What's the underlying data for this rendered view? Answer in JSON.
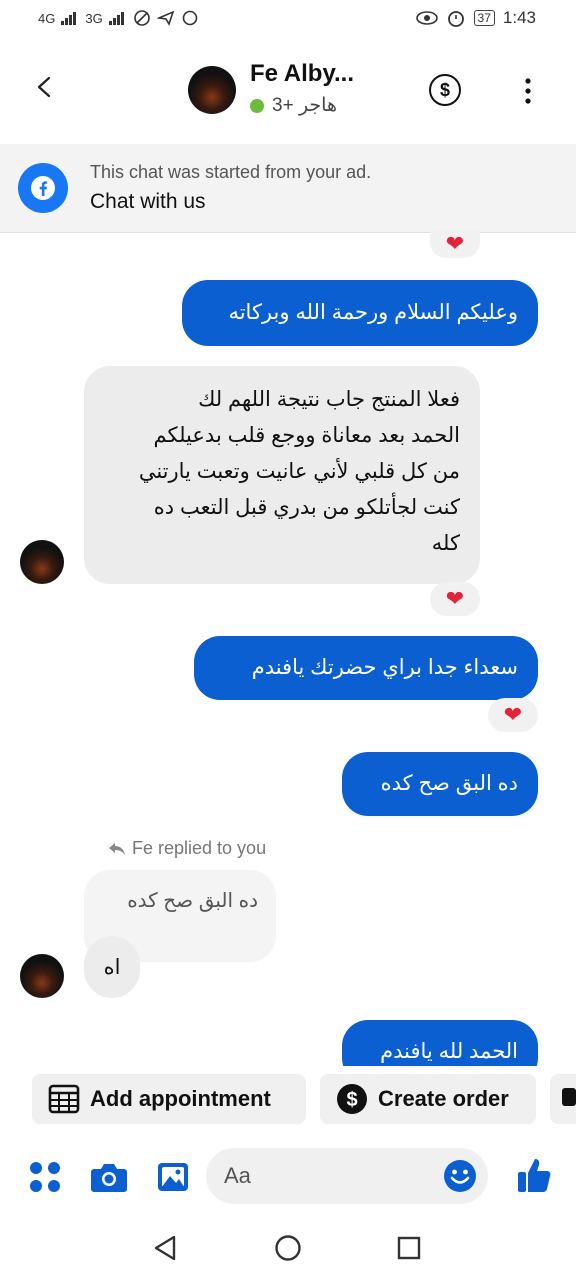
{
  "status_bar": {
    "network_1": "4G",
    "network_2": "3G",
    "battery": "37",
    "time": "1:43"
  },
  "header": {
    "back_icon": "chevron-left-icon",
    "title": "Fe Alby...",
    "subtitle": "هاجر +3",
    "status_color": "#6dbb3c",
    "dollar_icon": "dollar-circle-icon",
    "more_icon": "more-vertical-icon"
  },
  "ad_banner": {
    "icon": "facebook-icon",
    "note": "This chat was started from your ad.",
    "cta": "Chat with us"
  },
  "messages": [
    {
      "direction": "out",
      "text": "وعليكم السلام ورحمة الله وبركاته"
    },
    {
      "direction": "in",
      "lines": [
        "فعلا المنتج جاب نتيجة اللهم لك",
        "الحمد بعد معاناة ووجع قلب بدعيلكم",
        "من كل قلبي لأني عانيت وتعبت يارتني",
        "كنت لجأتلكو من بدري قبل التعب ده",
        "كله"
      ],
      "reaction": "heart"
    },
    {
      "direction": "out",
      "text": "سعداء جدا براي حضرتك يافندم",
      "reaction": "heart"
    },
    {
      "direction": "out",
      "text": "ده البق صح كده"
    },
    {
      "direction": "in",
      "reply_note": "Fe replied to you",
      "quoted": "ده البق صح كده",
      "text": "اه"
    },
    {
      "direction": "out",
      "text": "الحمد لله يافندم"
    }
  ],
  "quick_actions": [
    {
      "icon": "calendar-icon",
      "label": "Add appointment"
    },
    {
      "icon": "dollar-circle-icon",
      "label": "Create order"
    }
  ],
  "composer": {
    "placeholder": "Aa",
    "icons": [
      "apps-icon",
      "camera-icon",
      "image-icon",
      "emoji-icon",
      "thumbs-up-icon"
    ]
  },
  "colors": {
    "accent": "#0b5fd0",
    "reaction": "#e4233b",
    "messenger_blue": "#1877f2"
  }
}
